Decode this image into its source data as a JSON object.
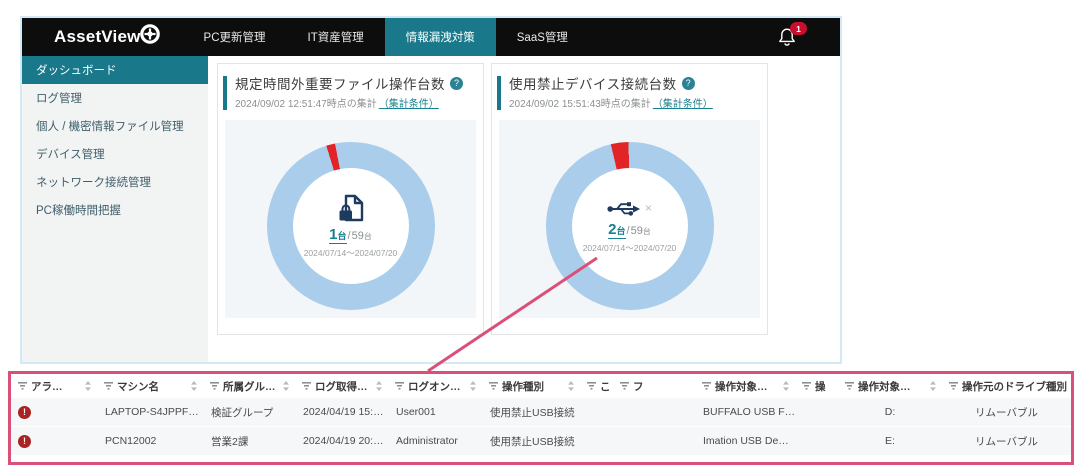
{
  "colors": {
    "accent": "#19798a",
    "donut_ring": "#a9cdeb",
    "donut_alert": "#e32426",
    "callout_pink": "#db5078",
    "alert_badge_red": "#a92323"
  },
  "nav": {
    "logo_text": "AssetView",
    "tabs": [
      {
        "label": "PC更新管理",
        "active": false
      },
      {
        "label": "IT資産管理",
        "active": false
      },
      {
        "label": "情報漏洩対策",
        "active": true
      },
      {
        "label": "SaaS管理",
        "active": false
      }
    ],
    "notification_count": "1"
  },
  "sidebar": {
    "items": [
      {
        "label": "ダッシュボード",
        "active": true
      },
      {
        "label": "ログ管理",
        "active": false
      },
      {
        "label": "個人 / 機密情報ファイル管理",
        "active": false
      },
      {
        "label": "デバイス管理",
        "active": false
      },
      {
        "label": "ネットワーク接続管理",
        "active": false
      },
      {
        "label": "PC稼働時間把握",
        "active": false
      }
    ]
  },
  "cards": [
    {
      "title": "規定時間外重要ファイル操作台数",
      "help": "?",
      "timestamp": "2024/09/02 12:51:47時点の集計",
      "condition_link": "（集計条件）",
      "icon": "locked-file-icon",
      "count": "1",
      "count_unit": "台",
      "separator": " / ",
      "total": "59",
      "total_unit": "台",
      "period": "2024/07/14～2024/07/20"
    },
    {
      "title": "使用禁止デバイス接続台数",
      "help": "?",
      "timestamp": "2024/09/02 15:51:43時点の集計",
      "condition_link": "（集計条件）",
      "icon": "usb-icon",
      "count": "2",
      "count_unit": "台",
      "separator": " / ",
      "total": "59",
      "total_unit": "台",
      "period": "2024/07/14～2024/07/20"
    }
  ],
  "table": {
    "headers": [
      {
        "label": "アラ…"
      },
      {
        "label": "マシン名"
      },
      {
        "label": "所属グル…"
      },
      {
        "label": "ログ取得…"
      },
      {
        "label": "ログオン…"
      },
      {
        "label": "操作種別"
      },
      {
        "label": "こ"
      },
      {
        "label": "フ"
      },
      {
        "label": "操作対象…"
      },
      {
        "label": "操"
      },
      {
        "label": "操作対象…"
      },
      {
        "label": "操作元のドライブ種別"
      }
    ],
    "rows": [
      {
        "alert": "!",
        "cells": [
          "LAPTOP-S4JPPF…",
          "検証グループ",
          "2024/04/19 15:…",
          "User001",
          "使用禁止USB接続",
          "",
          "",
          "BUFFALO USB F…",
          "",
          "D:",
          "リムーバブル"
        ]
      },
      {
        "alert": "!",
        "cells": [
          "PCN12002",
          "営業2課",
          "2024/04/19 20:…",
          "Administrator",
          "使用禁止USB接続",
          "",
          "",
          "Imation USB De…",
          "",
          "E:",
          "リムーバブル"
        ]
      }
    ]
  }
}
